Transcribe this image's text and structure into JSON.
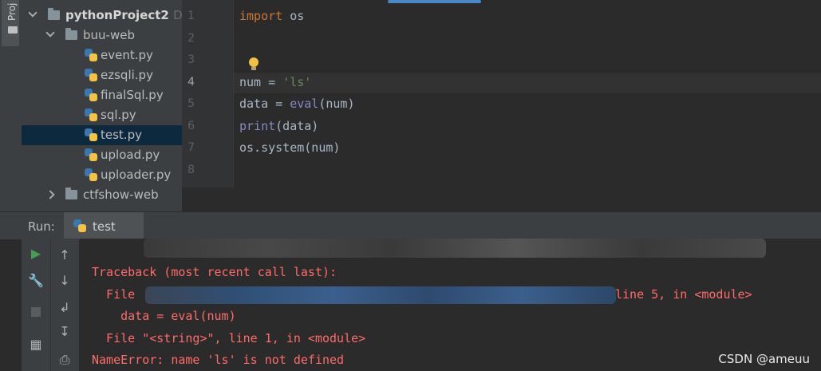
{
  "tool_strip": {
    "project_tab": "Proj"
  },
  "project_tree": {
    "root": {
      "name": "pythonProject2",
      "path_hint": "D:\\"
    },
    "folder_open": "buu-web",
    "files": [
      "event.py",
      "ezsqli.py",
      "finalSql.py",
      "sql.py",
      "test.py",
      "upload.py",
      "uploader.py"
    ],
    "selected_file": "test.py",
    "folder_collapsed": "ctfshow-web"
  },
  "editor": {
    "line_numbers": [
      "1",
      "2",
      "3",
      "4",
      "5",
      "6",
      "7",
      "8"
    ],
    "current_line": "4",
    "lines": {
      "l1": {
        "kw": "import",
        "rest": " os"
      },
      "l4": {
        "name": "num = ",
        "str": "'ls'"
      },
      "l5": {
        "prefix": "data = ",
        "fn": "eval",
        "rest": "(num)"
      },
      "l6": {
        "fn": "print",
        "rest": "(data)"
      },
      "l7": {
        "text": "os.system(num)"
      }
    }
  },
  "run_panel": {
    "label": "Run:",
    "tab": "test",
    "console": [
      "Traceback (most recent call last):",
      "  File",
      "line 5, in <module>",
      "    data = eval(num)",
      "  File \"<string>\", line 1, in <module>",
      "NameError: name 'ls' is not defined"
    ],
    "error_color": "#ff6b68"
  },
  "watermark": "CSDN @ameuu"
}
